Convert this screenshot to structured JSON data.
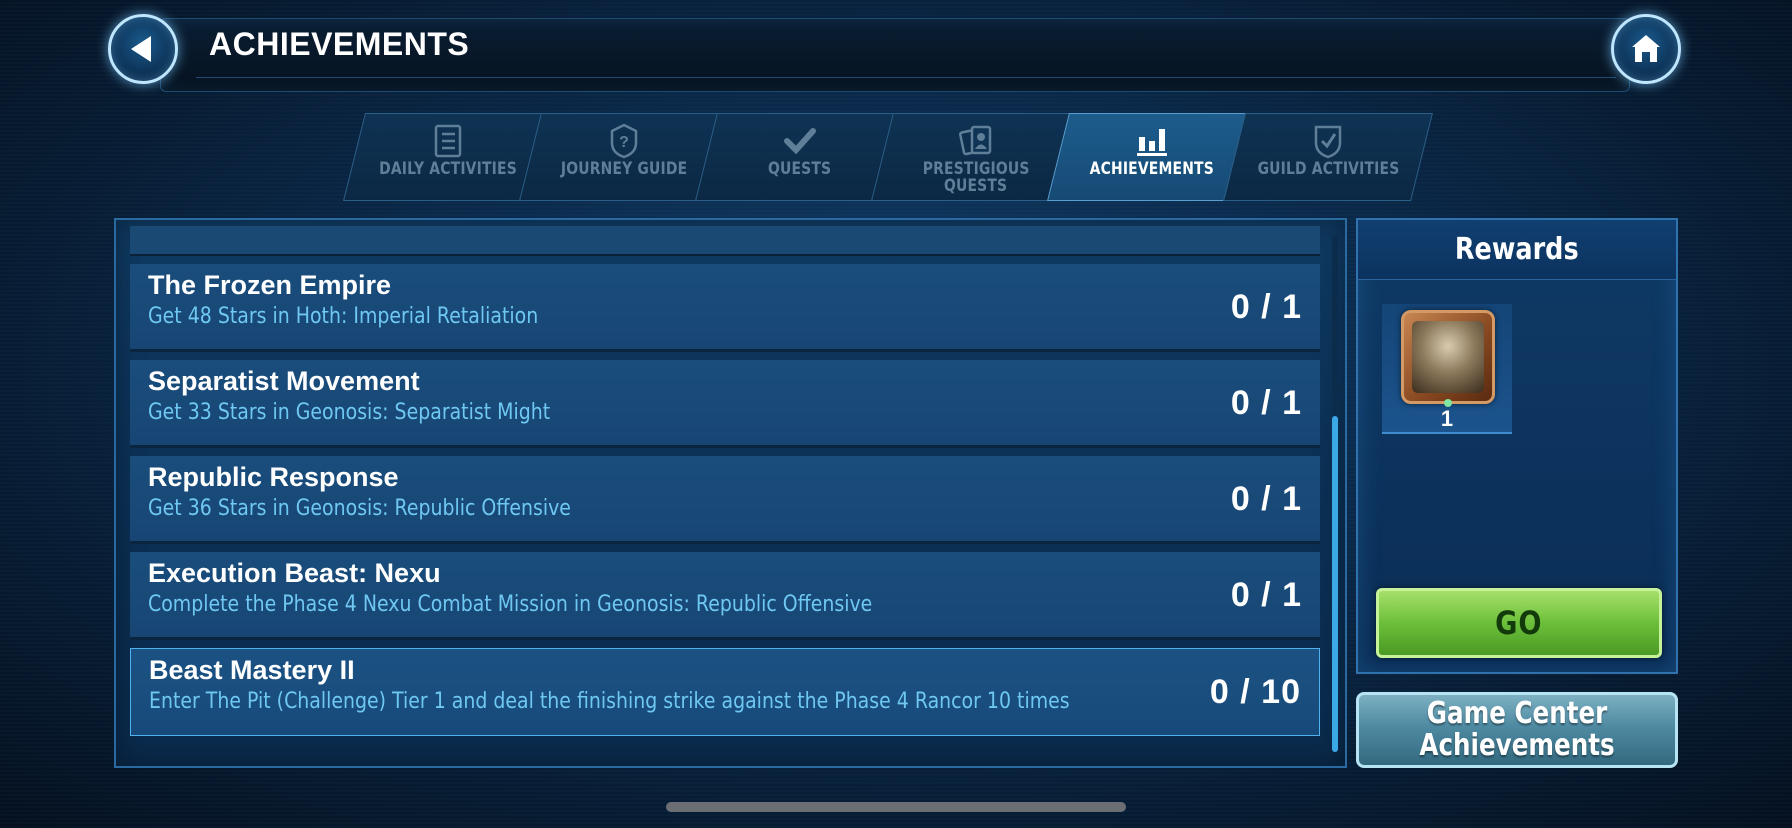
{
  "header": {
    "title": "ACHIEVEMENTS",
    "back_icon": "back-arrow-icon",
    "home_icon": "home-icon"
  },
  "tabs": [
    {
      "label": "DAILY ACTIVITIES",
      "icon": "checklist-icon",
      "active": false
    },
    {
      "label": "JOURNEY GUIDE",
      "icon": "shield-question-icon",
      "active": false
    },
    {
      "label": "QUESTS",
      "icon": "checkmark-icon",
      "active": false
    },
    {
      "label_line1": "PRESTIGIOUS",
      "label_line2": "QUESTS",
      "icon": "cards-icon",
      "active": false
    },
    {
      "label": "ACHIEVEMENTS",
      "icon": "bar-chart-icon",
      "active": true
    },
    {
      "label": "GUILD ACTIVITIES",
      "icon": "shield-check-icon",
      "active": false
    }
  ],
  "achievements": [
    {
      "title": "The Frozen Empire",
      "description": "Get 48 Stars in Hoth: Imperial Retaliation",
      "progress": "0 / 1"
    },
    {
      "title": "Separatist Movement",
      "description": "Get 33 Stars in Geonosis: Separatist Might",
      "progress": "0 / 1"
    },
    {
      "title": "Republic Response",
      "description": "Get 36 Stars in Geonosis: Republic Offensive",
      "progress": "0 / 1"
    },
    {
      "title": "Execution Beast: Nexu",
      "description": "Complete the Phase 4 Nexu Combat Mission in Geonosis: Republic Offensive",
      "progress": "0 / 1"
    },
    {
      "title": "Beast Mastery II",
      "description": "Enter The Pit (Challenge) Tier 1 and deal the finishing strike against the Phase 4 Rancor 10 times",
      "progress": "0 / 10",
      "selected": true
    }
  ],
  "rewards": {
    "title": "Rewards",
    "item_count": "1",
    "go_label": "GO"
  },
  "game_center": {
    "line1": "Game Center",
    "line2": "Achievements"
  },
  "colors": {
    "accent_blue": "#3aa9e6",
    "desc_text": "#6fc8f2",
    "go_green": "#6cbf3a"
  }
}
